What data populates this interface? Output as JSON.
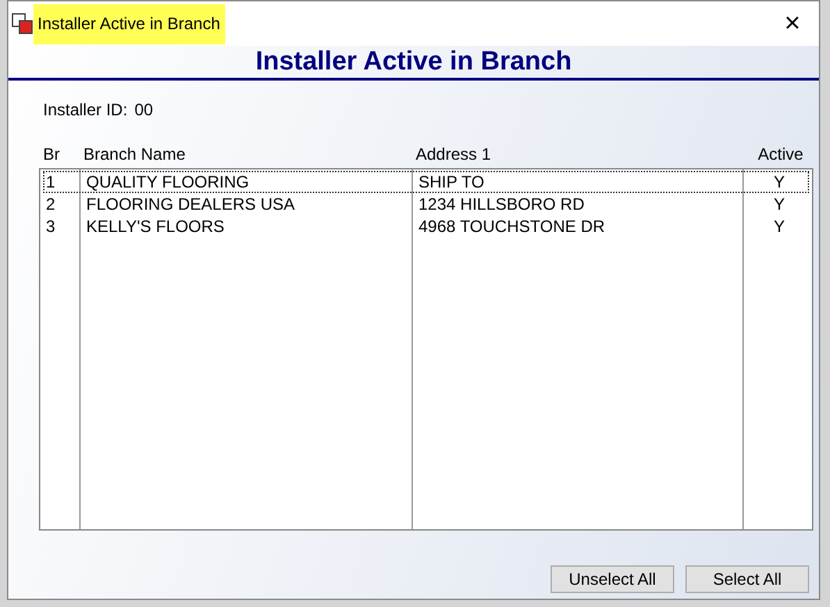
{
  "window": {
    "title": "Installer Active in Branch",
    "close": "×"
  },
  "header": "Installer Active in Branch",
  "installer_id": {
    "label": "Installer ID:",
    "value": "00"
  },
  "table": {
    "columns": [
      "Br",
      "Branch Name",
      "Address 1",
      "Active"
    ],
    "rows": [
      {
        "cells": [
          "1",
          "QUALITY FLOORING",
          "SHIP TO",
          "Y"
        ],
        "selected": true
      },
      {
        "cells": [
          "2",
          "FLOORING DEALERS USA",
          "1234 HILLSBORO RD",
          "Y"
        ],
        "selected": false
      },
      {
        "cells": [
          "3",
          "KELLY'S FLOORS",
          "4968 TOUCHSTONE DR",
          "Y"
        ],
        "selected": false
      }
    ]
  },
  "buttons": [
    "Unselect All",
    "Select All"
  ]
}
